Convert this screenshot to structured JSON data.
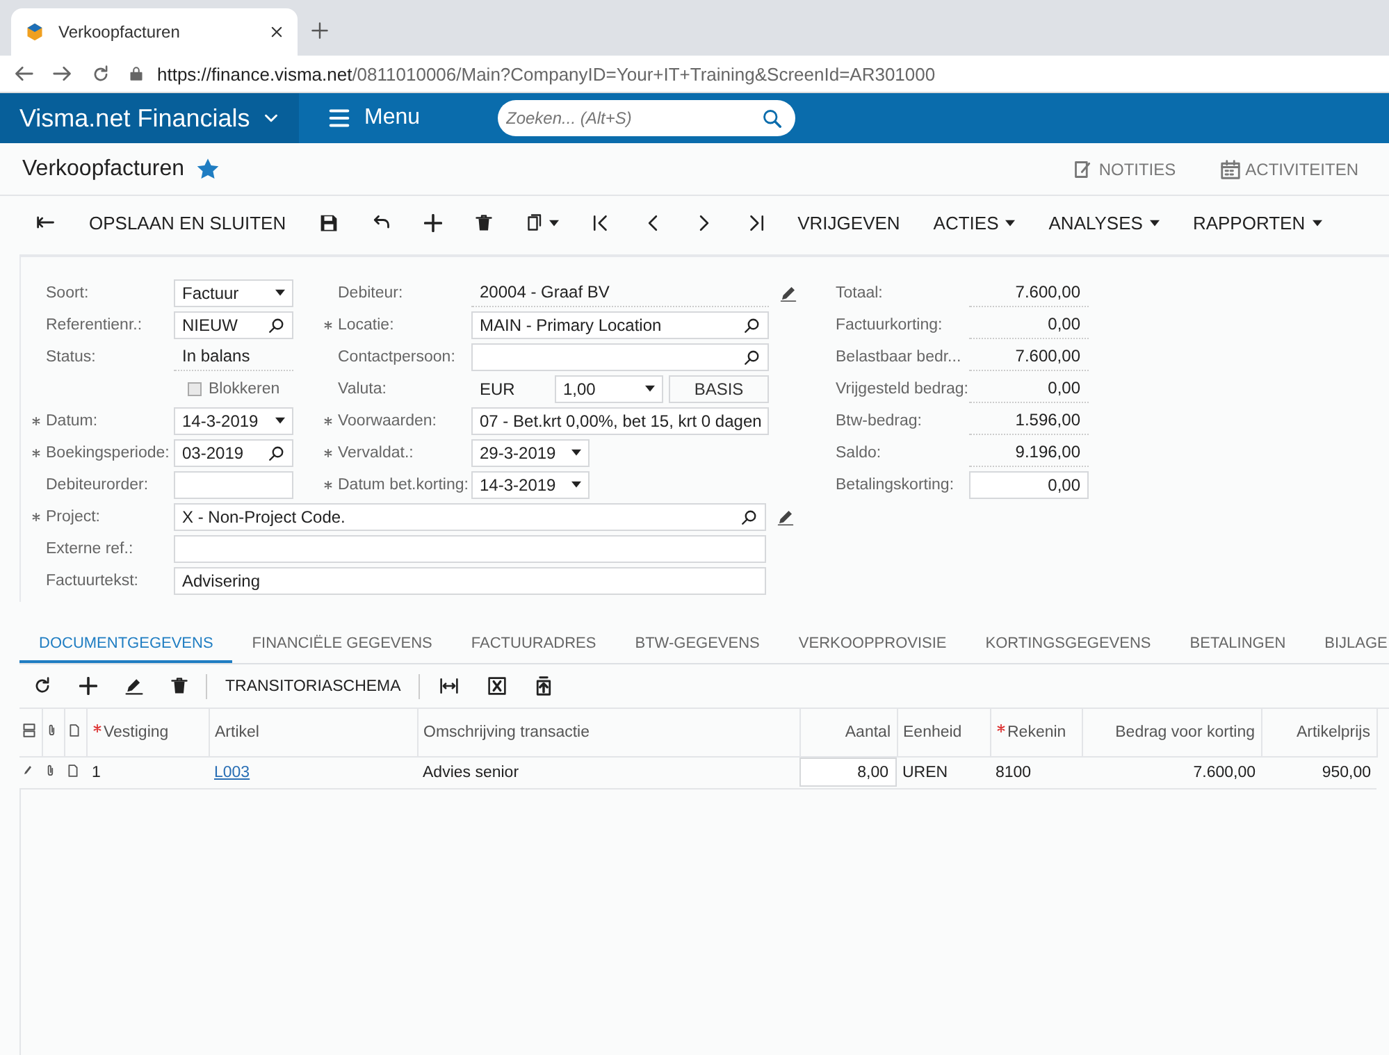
{
  "browser": {
    "tab_title": "Verkoopfacturen",
    "url_host": "https://finance.visma.net",
    "url_path": "/0811010006/Main?CompanyID=Your+IT+Training&ScreenId=AR301000"
  },
  "app_bar": {
    "brand": "Visma.net Financials",
    "menu": "Menu",
    "search": {
      "placeholder": "Zoeken... (Alt+S)"
    }
  },
  "page": {
    "title": "Verkoopfacturen",
    "favorite": true,
    "actions": [
      {
        "kind": "notes",
        "label": "NOTITIES"
      },
      {
        "kind": "activities",
        "label": "ACTIVITEITEN"
      }
    ]
  },
  "toolbar": [
    {
      "kind": "back",
      "caret": false
    },
    {
      "kind": "text",
      "label": "OPSLAAN EN SLUITEN",
      "caret": false
    },
    {
      "kind": "save",
      "caret": false
    },
    {
      "kind": "undo",
      "caret": false
    },
    {
      "kind": "add",
      "caret": false
    },
    {
      "kind": "delete",
      "caret": false
    },
    {
      "kind": "copy",
      "caret": true
    },
    {
      "kind": "first",
      "caret": false
    },
    {
      "kind": "prev",
      "caret": false
    },
    {
      "kind": "next",
      "caret": false
    },
    {
      "kind": "last",
      "caret": false
    },
    {
      "kind": "text",
      "label": "VRIJGEVEN",
      "caret": false
    },
    {
      "kind": "text",
      "label": "ACTIES",
      "caret": true
    },
    {
      "kind": "text",
      "label": "ANALYSES",
      "caret": true
    },
    {
      "kind": "text",
      "label": "RAPPORTEN",
      "caret": true
    }
  ],
  "form": {
    "left": [
      {
        "label": "Soort:",
        "kind": "dropdown",
        "value": "Factuur",
        "required": false
      },
      {
        "label": "Referentienr.:",
        "kind": "search",
        "value": "NIEUW",
        "required": false
      },
      {
        "label": "Status:",
        "kind": "readonly",
        "value": "In balans",
        "required": false
      },
      {
        "label": "Blokkeren",
        "kind": "checkbox",
        "checked": false
      },
      {
        "label": "Datum:",
        "kind": "dropdown",
        "value": "14-3-2019",
        "required": true
      },
      {
        "label": "Boekingsperiode:",
        "kind": "search",
        "value": "03-2019",
        "required": true
      },
      {
        "label": "Debiteurorder:",
        "kind": "text",
        "required": false
      }
    ],
    "middle": [
      {
        "label": "Debiteur:",
        "kind": "readonly",
        "value": "20004 - Graaf BV",
        "required": false,
        "edit_icon": true
      },
      {
        "label": "Locatie:",
        "kind": "search",
        "value": "MAIN - Primary Location",
        "required": true,
        "edit_icon": false
      },
      {
        "label": "Contactpersoon:",
        "kind": "search",
        "required": false,
        "edit_icon": false
      },
      {
        "label": "Valuta:",
        "kind": "currency",
        "value": "EUR",
        "rate": "1,00",
        "button": "BASIS",
        "required": false,
        "edit_icon": false
      },
      {
        "label": "Voorwaarden:",
        "kind": "search",
        "value": "07 - Bet.krt 0,00%, bet 15, krt 0 dagen",
        "required": true,
        "edit_icon": false
      },
      {
        "label": "Vervaldat.:",
        "kind": "dropdown",
        "value": "29-3-2019",
        "required": true,
        "edit_icon": false
      },
      {
        "label": "Datum bet.korting:",
        "kind": "dropdown",
        "value": "14-3-2019",
        "required": true,
        "edit_icon": false
      }
    ],
    "wide": [
      {
        "label": "Project:",
        "kind": "search",
        "value": "X - Non-Project Code.",
        "required": true,
        "edit_icon": true
      },
      {
        "label": "Externe ref.:",
        "kind": "text",
        "required": false,
        "edit_icon": false
      },
      {
        "label": "Factuurtekst:",
        "kind": "text",
        "value": "Advisering",
        "required": false,
        "edit_icon": false
      }
    ],
    "totals": [
      {
        "label": "Totaal:",
        "kind": "readonly",
        "value": "7.600,00"
      },
      {
        "label": "Factuurkorting:",
        "kind": "readonly",
        "value": "0,00"
      },
      {
        "label": "Belastbaar bedr...",
        "kind": "readonly",
        "value": "7.600,00"
      },
      {
        "label": "Vrijgesteld bedrag:",
        "kind": "readonly",
        "value": "0,00"
      },
      {
        "label": "Btw-bedrag:",
        "kind": "readonly",
        "value": "1.596,00"
      },
      {
        "label": "Saldo:",
        "kind": "readonly",
        "value": "9.196,00"
      },
      {
        "label": "Betalingskorting:",
        "kind": "input",
        "value": "0,00"
      }
    ]
  },
  "tabs": [
    {
      "label": "DOCUMENTGEGEVENS",
      "selected": true
    },
    {
      "label": "FINANCIËLE GEGEVENS",
      "selected": false
    },
    {
      "label": "FACTUURADRES",
      "selected": false
    },
    {
      "label": "BTW-GEGEVENS",
      "selected": false
    },
    {
      "label": "VERKOOPPROVISIE",
      "selected": false
    },
    {
      "label": "KORTINGSGEGEVENS",
      "selected": false
    },
    {
      "label": "BETALINGEN",
      "selected": false
    },
    {
      "label": "BIJLAGE",
      "selected": false
    }
  ],
  "grid_toolbar": [
    {
      "kind": "refresh"
    },
    {
      "kind": "add"
    },
    {
      "kind": "edit"
    },
    {
      "kind": "delete"
    },
    {
      "kind": "text",
      "label": "TRANSITORIASCHEMA"
    },
    {
      "kind": "fit"
    },
    {
      "kind": "excel"
    },
    {
      "kind": "upload"
    }
  ],
  "table": {
    "columns": [
      {
        "kind": "files-icon"
      },
      {
        "kind": "attach-icon"
      },
      {
        "kind": "note-icon"
      },
      {
        "kind": "text",
        "label": "Vestiging",
        "required": true
      },
      {
        "kind": "text",
        "label": "Artikel",
        "required": false
      },
      {
        "kind": "text",
        "label": "Omschrijving transactie",
        "required": false
      },
      {
        "kind": "number",
        "label": "Aantal",
        "required": false
      },
      {
        "kind": "text",
        "label": "Eenheid",
        "required": false
      },
      {
        "kind": "text",
        "label": "Rekenin",
        "required": true
      },
      {
        "kind": "number",
        "label": "Bedrag voor korting",
        "required": false
      },
      {
        "kind": "number",
        "label": "Artikelprijs",
        "required": false
      }
    ],
    "rows": [
      {
        "cells": [
          {
            "kind": "edit-icon"
          },
          {
            "kind": "attach-icon"
          },
          {
            "kind": "note-icon"
          },
          {
            "kind": "text",
            "value": "1"
          },
          {
            "kind": "link",
            "value": "L003"
          },
          {
            "kind": "text",
            "value": "Advies senior"
          },
          {
            "kind": "input",
            "value": "8,00"
          },
          {
            "kind": "text",
            "value": "UREN"
          },
          {
            "kind": "text",
            "value": "8100"
          },
          {
            "kind": "text",
            "value": "7.600,00"
          },
          {
            "kind": "text",
            "value": "950,00"
          }
        ]
      }
    ]
  }
}
